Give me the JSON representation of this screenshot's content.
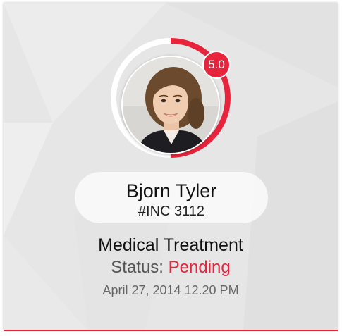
{
  "patient": {
    "name": "Bjorn Tyler",
    "incident_id": "#INC 3112",
    "rating": "5.0",
    "rating_fraction": 0.5,
    "avatar_icon": "portrait-photo"
  },
  "treatment": {
    "type": "Medical Treatment",
    "status_label": "Status:",
    "status_value": "Pending",
    "date": "April 27, 2014 12.20 PM"
  },
  "colors": {
    "accent": "#e8243c",
    "ring_base": "#ffffff",
    "background": "#e6e6e6"
  }
}
